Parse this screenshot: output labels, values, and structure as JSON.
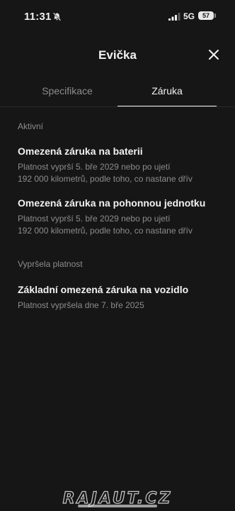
{
  "status_bar": {
    "time": "11:31",
    "network": "5G",
    "battery": "57"
  },
  "header": {
    "title": "Evička"
  },
  "tabs": [
    {
      "label": "Specifikace",
      "active": false
    },
    {
      "label": "Záruka",
      "active": true
    }
  ],
  "sections": [
    {
      "label": "Aktivní",
      "items": [
        {
          "title": "Omezená záruka na baterii",
          "desc_lines": [
            "Platnost vyprší 5. bře 2029 nebo po ujetí",
            "192 000 kilometrů, podle toho, co nastane dřív"
          ]
        },
        {
          "title": "Omezená záruka na pohonnou jednotku",
          "desc_lines": [
            "Platnost vyprší 5. bře 2029 nebo po ujetí",
            "192 000 kilometrů, podle toho, co nastane dřív"
          ]
        }
      ]
    },
    {
      "label": "Vypršela platnost",
      "items": [
        {
          "title": "Základní omezená záruka na vozidlo",
          "desc_lines": [
            "Platnost vypršela dne 7. bře 2025"
          ]
        }
      ]
    }
  ],
  "watermark": "RAJAUT.CZ",
  "icons": {
    "status": [
      "bell-slash-icon",
      "cellular-signal-icon",
      "battery-icon"
    ],
    "header": [
      "close-icon"
    ]
  },
  "colors": {
    "background": "#161616",
    "primary_text": "#f2f2f2",
    "secondary_text": "#8c8c8c"
  }
}
